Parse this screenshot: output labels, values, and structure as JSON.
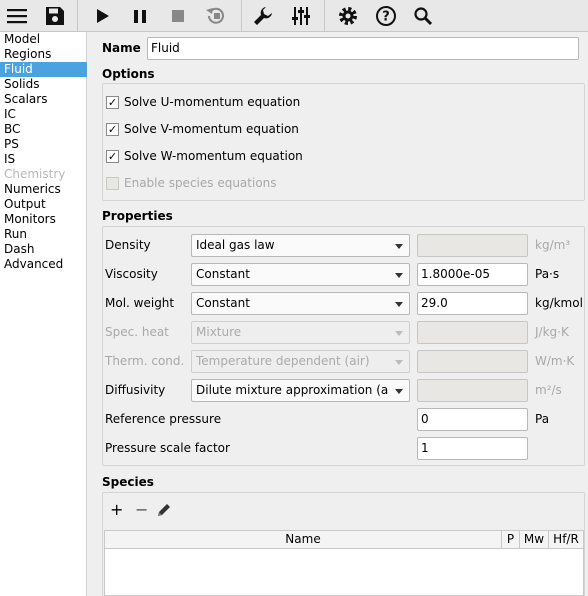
{
  "toolbar": {
    "icons": [
      "hamburger-menu-icon",
      "save-icon",
      "play-icon",
      "pause-icon",
      "stop-icon",
      "reset-icon",
      "wrench-icon",
      "sliders-icon",
      "gear-icon",
      "help-icon",
      "search-icon"
    ]
  },
  "sidebar": {
    "items": [
      {
        "label": "Model",
        "state": "normal"
      },
      {
        "label": "Regions",
        "state": "normal"
      },
      {
        "label": "Fluid",
        "state": "selected"
      },
      {
        "label": "Solids",
        "state": "normal"
      },
      {
        "label": "Scalars",
        "state": "normal"
      },
      {
        "label": "IC",
        "state": "normal"
      },
      {
        "label": "BC",
        "state": "normal"
      },
      {
        "label": "PS",
        "state": "normal"
      },
      {
        "label": "IS",
        "state": "normal"
      },
      {
        "label": "Chemistry",
        "state": "disabled"
      },
      {
        "label": "Numerics",
        "state": "normal"
      },
      {
        "label": "Output",
        "state": "normal"
      },
      {
        "label": "Monitors",
        "state": "normal"
      },
      {
        "label": "Run",
        "state": "normal"
      },
      {
        "label": "Dash",
        "state": "normal"
      },
      {
        "label": "Advanced",
        "state": "normal"
      }
    ],
    "collapse_glyph": "‹"
  },
  "main": {
    "name_label": "Name",
    "name_value": "Fluid",
    "options": {
      "title": "Options",
      "checkboxes": [
        {
          "label": "Solve U-momentum equation",
          "checked": true,
          "enabled": true,
          "mark": "✓"
        },
        {
          "label": "Solve V-momentum equation",
          "checked": true,
          "enabled": true,
          "mark": "✓"
        },
        {
          "label": "Solve W-momentum equation",
          "checked": true,
          "enabled": true,
          "mark": "✓"
        },
        {
          "label": "Enable species equations",
          "checked": false,
          "enabled": false,
          "mark": ""
        }
      ]
    },
    "properties": {
      "title": "Properties",
      "rows": [
        {
          "label": "Density",
          "combo": "Ideal gas law",
          "value": "",
          "unit": "kg/m³",
          "enabled": true,
          "value_enabled": false,
          "unit_grey": true
        },
        {
          "label": "Viscosity",
          "combo": "Constant",
          "value": "1.8000e-05",
          "unit": "Pa⋅s",
          "enabled": true,
          "value_enabled": true,
          "unit_grey": false
        },
        {
          "label": "Mol. weight",
          "combo": "Constant",
          "value": "29.0",
          "unit": "kg/kmol",
          "enabled": true,
          "value_enabled": true,
          "unit_grey": false
        },
        {
          "label": "Spec. heat",
          "combo": "Mixture",
          "value": "",
          "unit": "J/kg⋅K",
          "enabled": false,
          "value_enabled": false,
          "unit_grey": true
        },
        {
          "label": "Therm. cond.",
          "combo": "Temperature dependent (air)",
          "value": "",
          "unit": "W/m⋅K",
          "enabled": false,
          "value_enabled": false,
          "unit_grey": true
        },
        {
          "label": "Diffusivity",
          "combo": "Dilute mixture approximation (air)",
          "value": "",
          "unit": "m²/s",
          "enabled": true,
          "value_enabled": false,
          "unit_grey": true
        }
      ],
      "reference_pressure": {
        "label": "Reference pressure",
        "value": "0",
        "unit": "Pa"
      },
      "pressure_scale": {
        "label": "Pressure scale factor",
        "value": "1"
      }
    },
    "species": {
      "title": "Species",
      "add_glyph": "+",
      "remove_glyph": "−",
      "columns": [
        "Name",
        "P",
        "Mw",
        "Hf/R"
      ]
    }
  }
}
